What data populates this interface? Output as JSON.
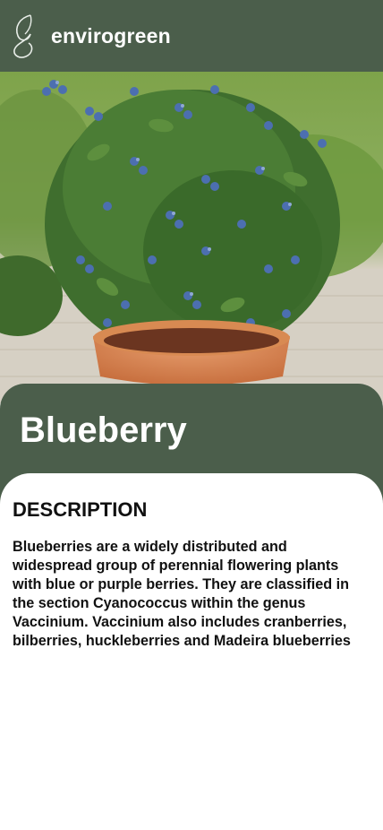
{
  "header": {
    "brand": "envirogreen",
    "logo_icon": "leaf-outline-icon",
    "background_color": "#4b5e4b"
  },
  "hero": {
    "image_subject": "potted-blueberry-bush"
  },
  "plant": {
    "name": "Blueberry"
  },
  "description": {
    "heading": "DESCRIPTION",
    "body": "Blueberries are a widely distributed and widespread group of perennial flowering plants with blue or purple berries. They are classified in the section Cyanococcus within the genus Vaccinium. Vaccinium also includes cranberries, bilberries, huckleberries and Madeira blueberries"
  },
  "colors": {
    "accent": "#4b5e4b",
    "text": "#111111",
    "card": "#ffffff"
  }
}
